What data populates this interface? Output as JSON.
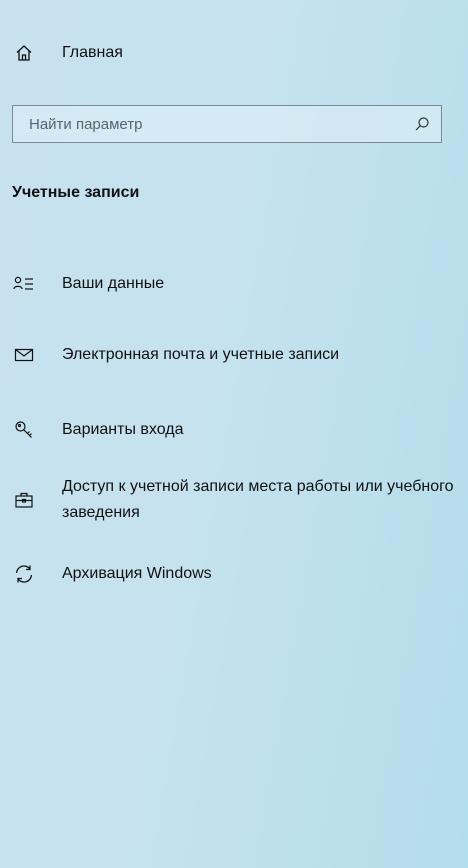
{
  "nav": {
    "home": {
      "label": "Главная",
      "icon": "home-icon"
    },
    "search": {
      "placeholder": "Найти параметр",
      "value": "",
      "icon": "search-icon"
    },
    "section_title": "Учетные записи",
    "items": [
      {
        "label": "Ваши данные",
        "icon": "person-list-icon"
      },
      {
        "label": "Электронная почта и учетные записи",
        "icon": "mail-icon"
      },
      {
        "label": "Варианты входа",
        "icon": "key-icon"
      },
      {
        "label": "Доступ к учетной записи места работы или учебного заведения",
        "icon": "briefcase-icon"
      },
      {
        "label": "Архивация Windows",
        "icon": "sync-icon"
      }
    ]
  },
  "colors": {
    "background": "#c6e2ef",
    "text": "#111111",
    "search_border": "#7a8a96"
  }
}
